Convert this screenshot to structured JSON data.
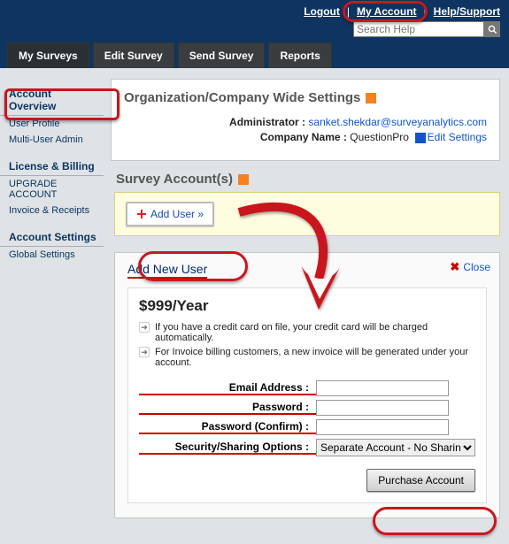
{
  "header": {
    "links": {
      "logout": "Logout",
      "my_account": "My Account",
      "help": "Help/Support"
    },
    "search": {
      "placeholder": "Search Help"
    }
  },
  "tabs": [
    "My Surveys",
    "Edit Survey",
    "Send Survey",
    "Reports"
  ],
  "sidebar": {
    "sections": [
      {
        "heading": "Account Overview",
        "items": [
          {
            "label": "User Profile"
          },
          {
            "label": "Multi-User Admin"
          }
        ]
      },
      {
        "heading": "License & Billing",
        "items": [
          {
            "label": "UPGRADE ACCOUNT"
          },
          {
            "label": "Invoice & Receipts"
          }
        ]
      },
      {
        "heading": "Account Settings",
        "items": [
          {
            "label": "Global Settings"
          }
        ]
      }
    ]
  },
  "org_panel": {
    "title": "Organization/Company Wide Settings",
    "admin_label": "Administrator :",
    "admin_value": "sanket.shekdar@surveyanalytics.com",
    "company_label": "Company Name :",
    "company_value": "QuestionPro",
    "edit_settings": "Edit Settings"
  },
  "survey_accounts": {
    "title": "Survey Account(s)",
    "add_user": "Add User »"
  },
  "modal": {
    "close": "Close",
    "title": "Add New User",
    "price": "$999/Year",
    "bullets": [
      "If you have a credit card on file, your credit card will be charged automatically.",
      "For Invoice billing customers, a new invoice will be generated under your account."
    ],
    "fields": {
      "email": "Email Address :",
      "password": "Password :",
      "confirm": "Password (Confirm) :",
      "security": "Security/Sharing Options :",
      "security_value": "Separate Account - No Sharing"
    },
    "purchase": "Purchase Account"
  },
  "annotation_colors": {
    "highlight": "#c8171d"
  }
}
